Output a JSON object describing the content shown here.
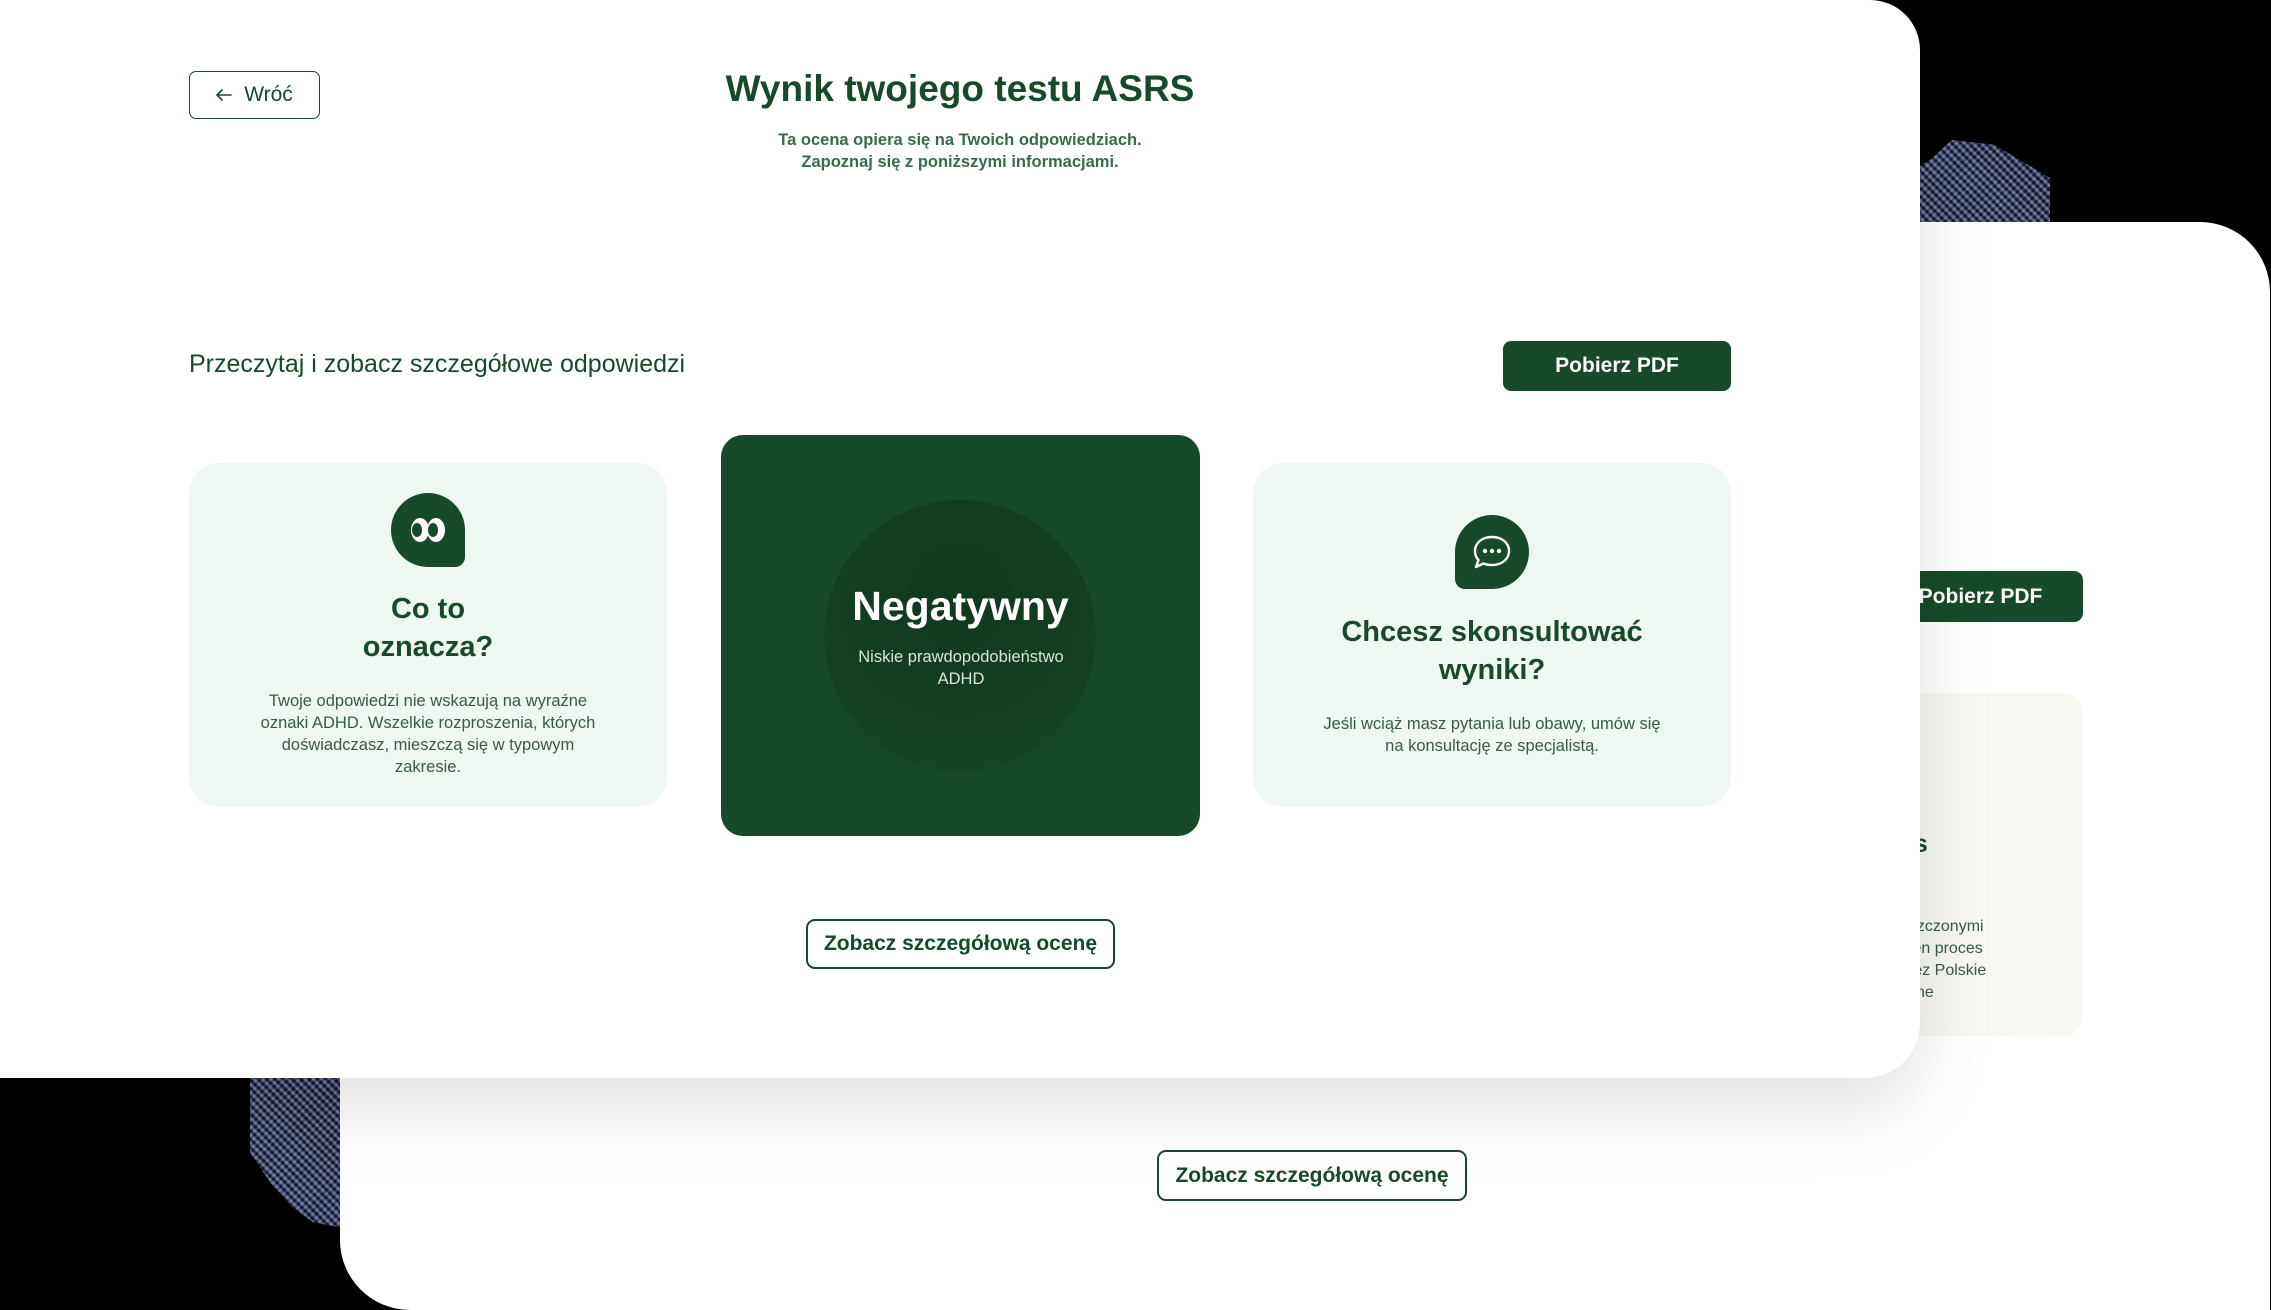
{
  "header": {
    "back_label": "Wróć",
    "title": "Wynik twojego testu ASRS",
    "subtitle_line1": "Ta ocena opiera się na Twoich odpowiedziach.",
    "subtitle_line2": "Zapoznaj się z poniższymi informacjami."
  },
  "section": {
    "label": "Przeczytaj i zobacz szczegółowe odpowiedzi",
    "pdf_button": "Pobierz PDF"
  },
  "cards": {
    "left": {
      "icon": "eyes-icon",
      "title": "Co to\noznacza?",
      "text": "Twoje odpowiedzi nie wskazują na wyraźne oznaki ADHD. Wszelkie rozproszenia, których doświadczasz, mieszczą się w typowym zakresie."
    },
    "result": {
      "title": "Negatywny",
      "subtitle": "Niskie prawdopodobieństwo ADHD"
    },
    "right": {
      "icon": "chat-bubble-icon",
      "title": "Chcesz skonsultować\nwyniki?",
      "text": "Jeśli wciąż masz pytania lub obawy, umów się na konsultację ze specjalistą."
    }
  },
  "detail_button": "Zobacz szczegółową ocenę",
  "background_card": {
    "pdf_button": "Pobierz PDF",
    "panel_title": "es\ny",
    "panel_text": "eszczonymi\nełen proces\nrzez Polskie\nczne",
    "detail_button": "Zobacz szczegółową ocenę"
  },
  "colors": {
    "primary": "#174a2a",
    "card_bg": "#eef7f1",
    "background": "#ffffff"
  }
}
